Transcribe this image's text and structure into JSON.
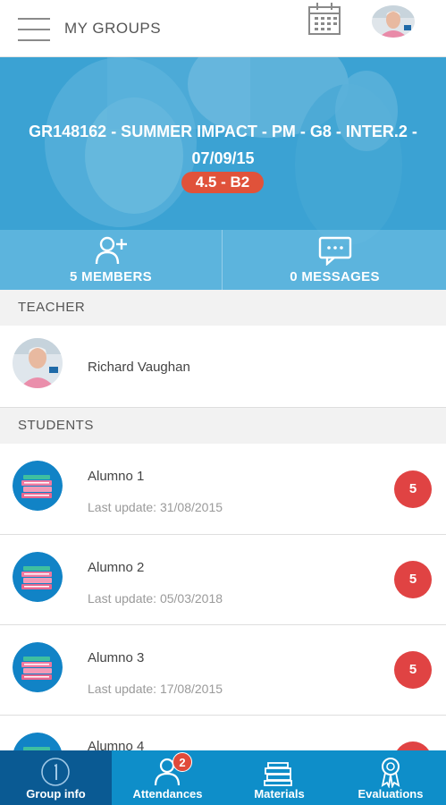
{
  "appbar": {
    "title": "MY GROUPS",
    "menu_icon": "hamburger-menu-icon",
    "calendar_icon": "calendar-icon"
  },
  "group": {
    "title": "GR148162 - SUMMER IMPACT - PM - G8 - INTER.2 - 07/09/15",
    "level_badge": "4.5 - B2",
    "members_label": "5 MEMBERS",
    "messages_label": "0 MESSAGES"
  },
  "teacher_section": {
    "header": "TEACHER",
    "name": "Richard Vaughan"
  },
  "students_section": {
    "header": "STUDENTS",
    "items": [
      {
        "name": "Alumno 1",
        "last_update": "Last update: 31/08/2015",
        "count": "5"
      },
      {
        "name": "Alumno 2",
        "last_update": "Last update: 05/03/2018",
        "count": "5"
      },
      {
        "name": "Alumno 3",
        "last_update": "Last update: 17/08/2015",
        "count": "5"
      },
      {
        "name": "Alumno 4",
        "last_update": "",
        "count": ""
      }
    ]
  },
  "bottom_nav": {
    "tabs": [
      {
        "label": "Group info",
        "icon": "info-circle-icon",
        "active": true
      },
      {
        "label": "Attendances",
        "icon": "person-icon",
        "badge": "2"
      },
      {
        "label": "Materials",
        "icon": "books-icon"
      },
      {
        "label": "Evaluations",
        "icon": "award-ribbon-icon"
      }
    ]
  },
  "colors": {
    "primary": "#0e8ec9",
    "primary_dark": "#0a5a93",
    "hero_blue": "#3ba3d4",
    "badge_red": "#e04343",
    "level_badge": "#e0523a"
  }
}
